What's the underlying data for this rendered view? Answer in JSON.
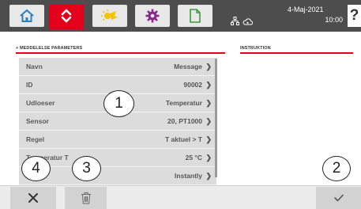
{
  "top_bar": {
    "tabs": [
      {
        "icon": "home-icon"
      },
      {
        "icon": "swap-arrows-icon",
        "active": true
      },
      {
        "icon": "weather-icon"
      },
      {
        "icon": "gear-icon"
      },
      {
        "icon": "document-icon"
      }
    ],
    "date": "4-Maj-2021",
    "time": "10:00",
    "help_label": "?"
  },
  "params_section": {
    "title": "+ MEDDELELSE PARAMETERS",
    "rows": [
      {
        "name": "Navn",
        "value": "Message"
      },
      {
        "name": "ID",
        "value": "90002"
      },
      {
        "name": "Udloeser",
        "value": "Temperatur"
      },
      {
        "name": "Sensor",
        "value": "20, PT1000"
      },
      {
        "name": "Regel",
        "value": "T aktuel > T"
      },
      {
        "name": "Temperatur T",
        "value": "25 °C"
      },
      {
        "name": "",
        "value": "Instantly"
      }
    ]
  },
  "instruction_section": {
    "title": "INSTRUKTION"
  },
  "callouts": [
    "1",
    "2",
    "3",
    "4"
  ],
  "bottom_bar": {
    "buttons": [
      "close-icon",
      "trash-icon",
      "check-icon"
    ]
  },
  "colors": {
    "accent_red": "#e3001b",
    "top_bar_bg": "#4d4d4d",
    "row_bg": "#dcdcdc"
  }
}
